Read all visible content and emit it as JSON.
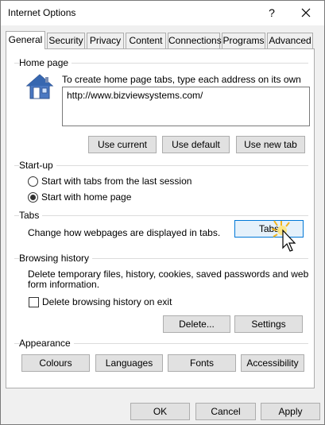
{
  "window": {
    "title": "Internet Options",
    "help_glyph": "?",
    "close_glyph": "✕"
  },
  "tabs": [
    {
      "label": "General",
      "active": true
    },
    {
      "label": "Security"
    },
    {
      "label": "Privacy"
    },
    {
      "label": "Content"
    },
    {
      "label": "Connections"
    },
    {
      "label": "Programs"
    },
    {
      "label": "Advanced"
    }
  ],
  "home_page": {
    "group_title": "Home page",
    "instructions": "To create home page tabs, type each address on its own line.",
    "address_value": "http://www.bizviewsystems.com/",
    "use_current": "Use current",
    "use_default": "Use default",
    "use_new_tab": "Use new tab"
  },
  "startup": {
    "group_title": "Start-up",
    "option_last_session": "Start with tabs from the last session",
    "option_home_page": "Start with home page",
    "selected": "option_home_page"
  },
  "tabs_group": {
    "group_title": "Tabs",
    "description": "Change how webpages are displayed in tabs.",
    "tabs_button": "Tabs"
  },
  "browsing_history": {
    "group_title": "Browsing history",
    "description_line1": "Delete temporary files, history, cookies, saved passwords and web",
    "description_line2": "form information.",
    "delete_on_exit_label": "Delete browsing history on exit",
    "delete_on_exit_checked": false,
    "delete_button": "Delete...",
    "settings_button": "Settings"
  },
  "appearance": {
    "group_title": "Appearance",
    "colours": "Colours",
    "languages": "Languages",
    "fonts": "Fonts",
    "accessibility": "Accessibility"
  },
  "footer": {
    "ok": "OK",
    "cancel": "Cancel",
    "apply": "Apply"
  },
  "icons": {
    "home": "house-icon",
    "cursor": "mouse-pointer-icon"
  }
}
